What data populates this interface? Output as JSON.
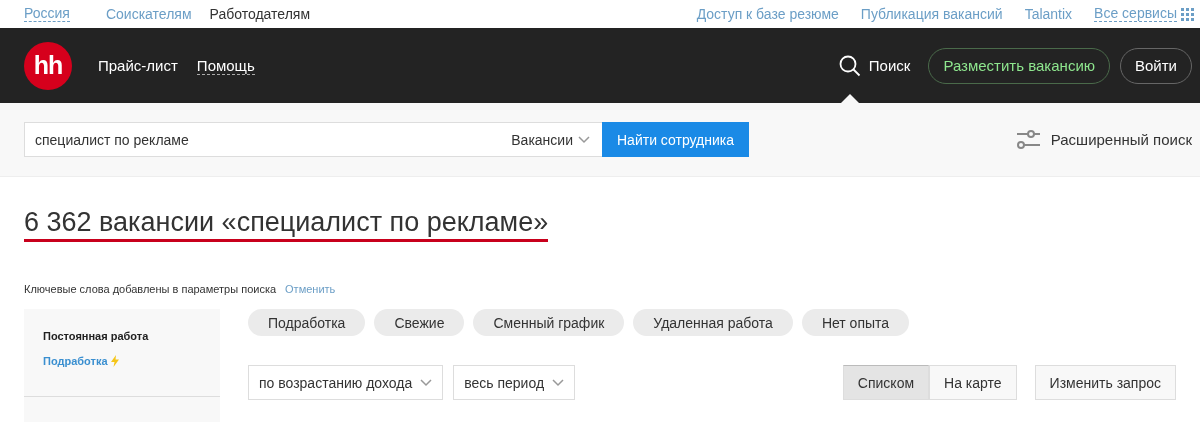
{
  "top_bar": {
    "region": "Россия",
    "audiences": [
      {
        "label": "Соискателям",
        "selected": false
      },
      {
        "label": "Работодателям",
        "selected": true
      }
    ],
    "links": [
      "Доступ к базе резюме",
      "Публикация вакансий",
      "Talantix"
    ],
    "all_services": "Все сервисы"
  },
  "header": {
    "logo": "hh",
    "nav": [
      "Прайс-лист",
      "Помощь"
    ],
    "search_link": {
      "label": "Поиск",
      "selected": true
    },
    "post_button": "Разместить вакансию",
    "login_button": "Войти"
  },
  "search": {
    "value": "специалист по рекламе",
    "scope": "Вакансии",
    "submit": "Найти сотрудника",
    "advanced": "Расширенный поиск"
  },
  "results": {
    "title": "6 362 вакансии «специалист по рекламе»",
    "note": "Ключевые слова добавлены в параметры поиска",
    "cancel": "Отменить"
  },
  "sidebar": {
    "items": [
      {
        "label": "Постоянная работа",
        "kind": "heading"
      },
      {
        "label": "Подработка",
        "kind": "link"
      }
    ]
  },
  "chips": [
    "Подработка",
    "Свежие",
    "Сменный график",
    "Удаленная работа",
    "Нет опыта"
  ],
  "sort": {
    "order": "по возрастанию дохода",
    "period": "весь период"
  },
  "views": [
    {
      "label": "Списком",
      "selected": true
    },
    {
      "label": "На карте",
      "selected": false
    }
  ],
  "change_query": "Изменить запрос"
}
